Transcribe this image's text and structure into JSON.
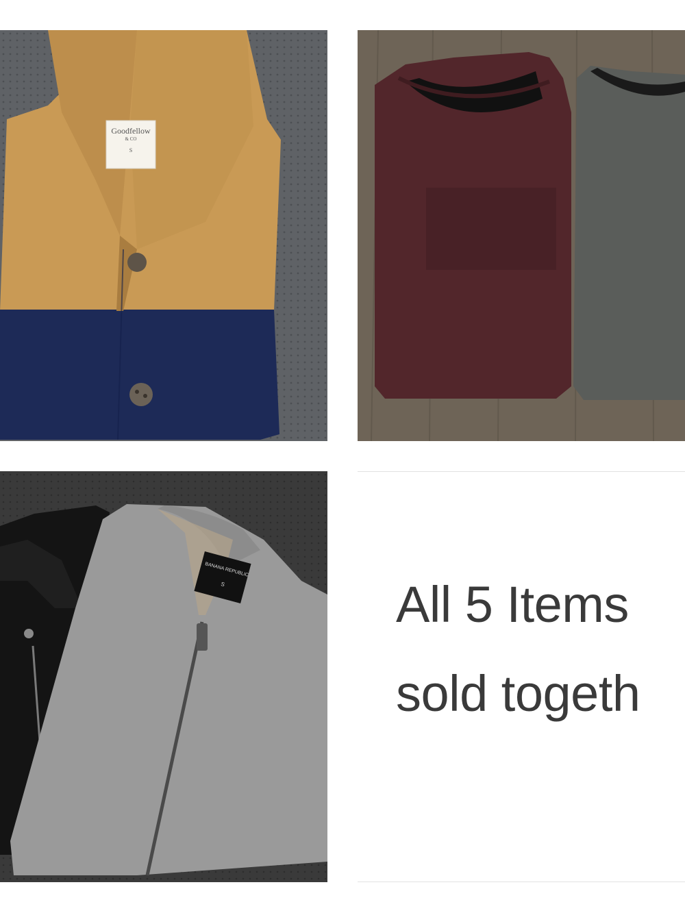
{
  "photos": {
    "cardigan": {
      "label_brand": "Goodfellow",
      "label_sub": "& CO",
      "label_size": "S",
      "colors": {
        "mustard": "#c99a55",
        "navy": "#1d2a57",
        "background": "#5f6266"
      }
    },
    "tees": {
      "colors": {
        "burgundy": "#52262b",
        "charcoal": "#5a5d5a",
        "floor": "#6e6457"
      }
    },
    "jackets": {
      "label_brand": "BANANA REPUBLIC",
      "label_size": "S",
      "colors": {
        "grey": "#9a9a9a",
        "black": "#141414",
        "background": "#3a3a3a"
      }
    }
  },
  "caption": {
    "line1": "All 5 Items",
    "line2": "sold togeth"
  }
}
